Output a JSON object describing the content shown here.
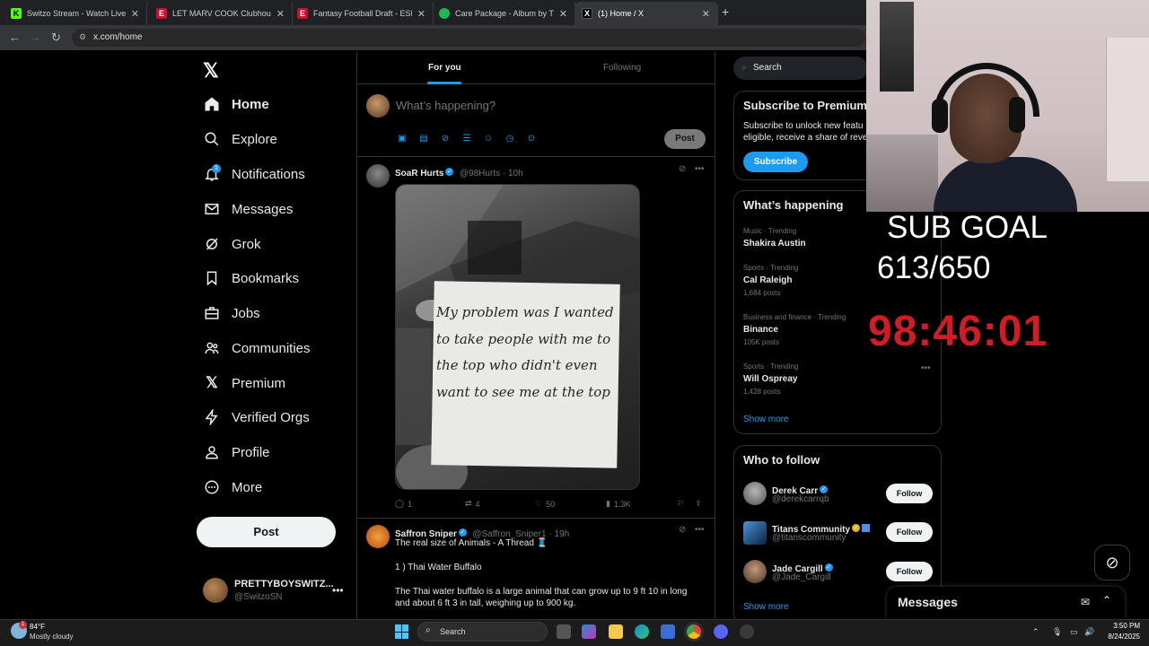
{
  "browser": {
    "tabs": [
      {
        "title": "Switzo Stream - Watch Live on",
        "favicon_color": "#53fc18",
        "favicon_glyph": "K"
      },
      {
        "title": "LET MARV COOK Clubhouse - E",
        "favicon_color": "#c8102e",
        "favicon_glyph": "E"
      },
      {
        "title": "Fantasy Football Draft - ESPN",
        "favicon_color": "#c8102e",
        "favicon_glyph": "E"
      },
      {
        "title": "Care Package - Album by Tray S",
        "favicon_color": "#1db954",
        "favicon_glyph": "●"
      },
      {
        "title": "(1) Home / X",
        "favicon_color": "#000000",
        "favicon_glyph": "X"
      }
    ],
    "url": "x.com/home"
  },
  "nav": {
    "items": [
      {
        "label": "Home",
        "icon": "home-icon"
      },
      {
        "label": "Explore",
        "icon": "search-icon"
      },
      {
        "label": "Notifications",
        "icon": "bell-icon"
      },
      {
        "label": "Messages",
        "icon": "envelope-icon"
      },
      {
        "label": "Grok",
        "icon": "grok-icon"
      },
      {
        "label": "Bookmarks",
        "icon": "bookmark-icon"
      },
      {
        "label": "Jobs",
        "icon": "briefcase-icon"
      },
      {
        "label": "Communities",
        "icon": "people-icon"
      },
      {
        "label": "Premium",
        "icon": "x-logo-icon"
      },
      {
        "label": "Verified Orgs",
        "icon": "lightning-icon"
      },
      {
        "label": "Profile",
        "icon": "person-icon"
      },
      {
        "label": "More",
        "icon": "more-circle-icon"
      }
    ],
    "notifications_badge": "1",
    "post_label": "Post",
    "account": {
      "name": "PRETTYBOYSWITZ...",
      "handle": "@SwitzoSN"
    }
  },
  "feed": {
    "tabs": {
      "for_you": "For you",
      "following": "Following"
    },
    "compose": {
      "placeholder": "What’s happening?",
      "post_label": "Post"
    },
    "tweet1": {
      "name": "SoaR Hurts",
      "meta": "@98Hurts · 10h",
      "image_text": "My problem was I wanted to take people with me to the top who didn't even want to see me at the top",
      "replies": "1",
      "reposts": "4",
      "likes": "50",
      "views": "1.3K"
    },
    "tweet2": {
      "name": "Saffron Sniper",
      "meta": "@Saffron_Sniper1 · 19h",
      "line1": "The real size of Animals - A Thread 🧵",
      "line2": "1 ) Thai Water Buffalo",
      "line3": "The Thai water buffalo is a large animal that can grow up to 9 ft 10 in long",
      "line4": "and about 6 ft 3 in tall, weighing up to 900 kg."
    }
  },
  "sidebar": {
    "search_placeholder": "Search",
    "premium": {
      "title": "Subscribe to Premium",
      "line1": "Subscribe to unlock new featu",
      "line2": "eligible, receive a share of reve",
      "button": "Subscribe"
    },
    "happening": {
      "title": "What’s happening",
      "trends": [
        {
          "context": "Music · Trending",
          "name": "Shakira Austin",
          "posts": ""
        },
        {
          "context": "Sports · Trending",
          "name": "Cal Raleigh",
          "posts": "1,684 posts"
        },
        {
          "context": "Business and finance · Trending",
          "name": "Binance",
          "posts": "105K posts"
        },
        {
          "context": "Sports · Trending",
          "name": "Will Ospreay",
          "posts": "1,428 posts"
        }
      ],
      "show_more": "Show more"
    },
    "who_to_follow": {
      "title": "Who to follow",
      "people": [
        {
          "name": "Derek Carr",
          "handle": "@derekcarrqb",
          "button": "Follow"
        },
        {
          "name": "Titans Community",
          "handle": "@titanscommunity",
          "button": "Follow"
        },
        {
          "name": "Jade Cargill",
          "handle": "@Jade_Cargill",
          "button": "Follow"
        }
      ],
      "show_more": "Show more"
    }
  },
  "messages_drawer": {
    "title": "Messages"
  },
  "overlay": {
    "sub_goal_label": "SUB GOAL",
    "sub_goal_count": "613/650",
    "countdown": "98:46:01"
  },
  "taskbar": {
    "weather_temp": "84°F",
    "weather_desc": "Mostly cloudy",
    "weather_badge": "1",
    "search_label": "Search",
    "time": "3:50 PM",
    "date": "8/24/2025"
  },
  "colors": {
    "accent": "#1d9bf0",
    "countdown": "#d01d25",
    "background": "#000000"
  }
}
